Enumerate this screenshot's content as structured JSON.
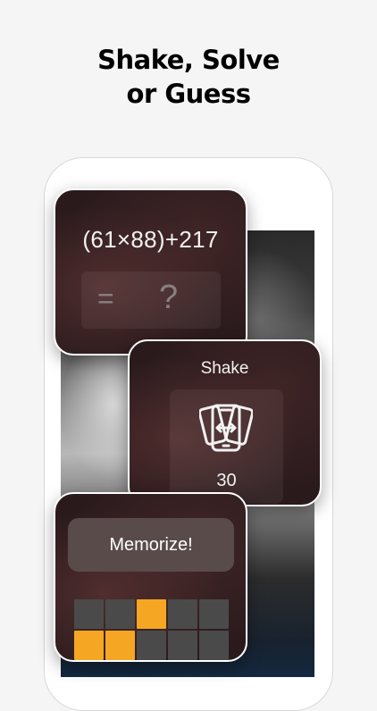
{
  "headline": {
    "line1": "Shake, Solve",
    "line2": "or Guess"
  },
  "math_card": {
    "expression": "(61×88)+217",
    "equals": "=",
    "answer_placeholder": "?"
  },
  "shake_card": {
    "title": "Shake",
    "icon": "phone-shake-icon",
    "count": "30"
  },
  "memorize_card": {
    "button_label": "Memorize!",
    "grid": [
      [
        0,
        0,
        1,
        0,
        0
      ],
      [
        1,
        1,
        0,
        0,
        0
      ]
    ]
  },
  "colors": {
    "highlight": "#f5a623",
    "cell": "#4a4a4a",
    "card_bg": "#2a1a1c",
    "button_bg": "#5a4b4b"
  }
}
